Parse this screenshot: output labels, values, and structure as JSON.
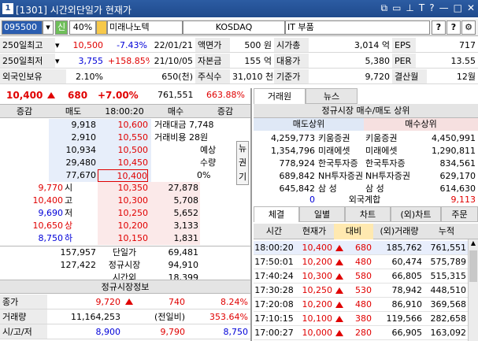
{
  "window": {
    "number": "1",
    "title": "[1301] 시간외단일가 현재가"
  },
  "toolbar": {
    "code": "095500",
    "flag": "신",
    "ratio": "40%",
    "name": "미래나노텍",
    "market": "KOSDAQ",
    "sector": "IT 부품",
    "q1": "?",
    "q2": "?"
  },
  "stock_info": {
    "rows": [
      {
        "label": "250일최고",
        "value": "10,500",
        "rate": "-7.43%",
        "date": "22/01/21",
        "l2": "액면가",
        "v2": "500 원",
        "l3": "시가총",
        "v3": "3,014 억",
        "l4": "EPS",
        "v4": "717"
      },
      {
        "label": "250일최저",
        "value": "3,755",
        "rate": "+158.85%",
        "date": "21/10/05",
        "l2": "자본금",
        "v2": "155 억",
        "l3": "대용가",
        "v3": "5,380",
        "l4": "PER",
        "v4": "13.55"
      },
      {
        "label": "외국인보유",
        "value": "2.10%",
        "rate": "650(천)",
        "date": "",
        "l2": "주식수",
        "v2": "31,010 천",
        "l3": "기준가",
        "v3": "9,720",
        "l4": "결산월",
        "v4": "12월"
      }
    ]
  },
  "price_line": {
    "price": "10,400",
    "change": "680",
    "rate": "+7.00%",
    "volume": "761,551",
    "pct": "663.88%"
  },
  "orderbook": {
    "headers": [
      "증감",
      "매도",
      "18:00:20",
      "매수",
      "증감"
    ],
    "asks": [
      {
        "qty": "9,918",
        "price": "10,600"
      },
      {
        "qty": "2,910",
        "price": "10,550"
      },
      {
        "qty": "10,934",
        "price": "10,500"
      },
      {
        "qty": "29,480",
        "price": "10,450"
      },
      {
        "qty": "77,670",
        "price": "10,400"
      }
    ],
    "bids": [
      {
        "price": "10,350",
        "qty": "27,878"
      },
      {
        "price": "10,300",
        "qty": "5,708"
      },
      {
        "price": "10,250",
        "qty": "5,652"
      },
      {
        "price": "10,200",
        "qty": "3,133"
      },
      {
        "price": "10,150",
        "qty": "1,831"
      }
    ],
    "ohlc": [
      {
        "v": "9,770",
        "k": "시"
      },
      {
        "v": "10,400",
        "k": "고"
      },
      {
        "v": "9,690",
        "k": "저"
      },
      {
        "v": "10,650",
        "k": "상"
      },
      {
        "v": "8,750",
        "k": "하"
      }
    ],
    "trade_amount_label": "거래대금 7,748",
    "trade_cost_label": "거래비용 28원",
    "expect_label1": "예상",
    "expect_label2": "수량",
    "expect_pct": "0%",
    "side_tabs": [
      "뉴",
      "권",
      "기"
    ],
    "total_ask": "157,957",
    "total_bid": "69,481",
    "total_label": "단일가",
    "reg_ask": "127,422",
    "reg_bid": "94,910",
    "reg_label": "정규시장",
    "after_label": "시간외",
    "after_bid": "18,399"
  },
  "regular_info": {
    "title": "정규시장정보",
    "close_label": "종가",
    "close": "9,720",
    "close_change": "740",
    "close_rate": "8.24%",
    "vol_label": "거래량",
    "vol": "11,164,253",
    "vol_prev_label": "(전일비)",
    "vol_rate": "353.64%",
    "hlc_label": "시/고/저",
    "open": "8,900",
    "high": "9,790",
    "low": "8,750"
  },
  "broker": {
    "tabs": [
      "거래원",
      "뉴스"
    ],
    "title": "정규시장 매수/매도 상위",
    "sell_label": "매도상위",
    "buy_label": "매수상위",
    "rows": [
      {
        "sq": "4,259,773",
        "sn": "키움증권",
        "bn": "키움증권",
        "bq": "4,450,991"
      },
      {
        "sq": "1,354,796",
        "sn": "미래에셋",
        "bn": "미래에셋",
        "bq": "1,290,811"
      },
      {
        "sq": "778,924",
        "sn": "한국투자증",
        "bn": "한국투자증",
        "bq": "834,561"
      },
      {
        "sq": "689,842",
        "sn": "NH투자증권",
        "bn": "NH투자증권",
        "bq": "629,170"
      },
      {
        "sq": "645,842",
        "sn": "삼 성",
        "bn": "삼 성",
        "bq": "614,630"
      }
    ],
    "foreign_sell": "0",
    "foreign_label": "외국계합",
    "foreign_buy": "9,113"
  },
  "ticks": {
    "tabs": [
      "체결",
      "일별",
      "차트",
      "(외)차트",
      "주문"
    ],
    "headers": [
      "시간",
      "현재가",
      "대비",
      "(외)거래량",
      "누적"
    ],
    "rows": [
      {
        "time": "18:00:20",
        "price": "10,400",
        "diff": "680",
        "vol": "185,762",
        "cum": "761,551"
      },
      {
        "time": "17:50:01",
        "price": "10,200",
        "diff": "480",
        "vol": "60,474",
        "cum": "575,789"
      },
      {
        "time": "17:40:24",
        "price": "10,300",
        "diff": "580",
        "vol": "66,805",
        "cum": "515,315"
      },
      {
        "time": "17:30:28",
        "price": "10,250",
        "diff": "530",
        "vol": "78,942",
        "cum": "448,510"
      },
      {
        "time": "17:20:08",
        "price": "10,200",
        "diff": "480",
        "vol": "86,910",
        "cum": "369,568"
      },
      {
        "time": "17:10:15",
        "price": "10,100",
        "diff": "380",
        "vol": "119,566",
        "cum": "282,658"
      },
      {
        "time": "17:00:27",
        "price": "10,000",
        "diff": "280",
        "vol": "66,905",
        "cum": "163,092"
      }
    ]
  }
}
